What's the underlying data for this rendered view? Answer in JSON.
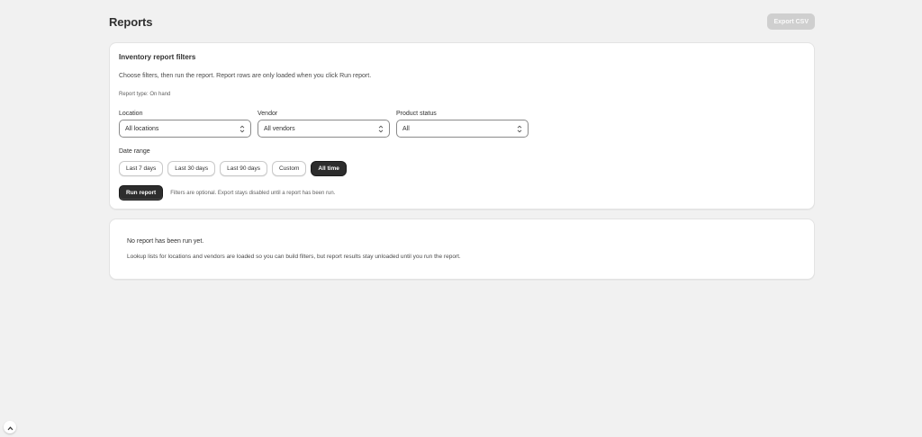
{
  "header": {
    "title": "Reports",
    "export_label": "Export CSV"
  },
  "filters": {
    "title": "Inventory report filters",
    "description": "Choose filters, then run the report. Report rows are only loaded when you click Run report.",
    "report_type": "Report type: On hand",
    "location": {
      "label": "Location",
      "value": "All locations"
    },
    "vendor": {
      "label": "Vendor",
      "value": "All vendors"
    },
    "product_status": {
      "label": "Product status",
      "value": "All"
    },
    "date_range_label": "Date range",
    "date_ranges": [
      {
        "label": "Last 7 days",
        "active": false
      },
      {
        "label": "Last 30 days",
        "active": false
      },
      {
        "label": "Last 90 days",
        "active": false
      },
      {
        "label": "Custom",
        "active": false
      },
      {
        "label": "All time",
        "active": true
      }
    ],
    "run_label": "Run report",
    "run_hint": "Filters are optional. Export stays disabled until a report has been run."
  },
  "results": {
    "title": "No report has been run yet.",
    "description": "Lookup lists for locations and vendors are loaded so you can build filters, but report results stay unloaded until you run the report."
  },
  "icons": {
    "select_chevron": "chevron-up-down-icon",
    "scroll_top": "chevron-up-icon"
  },
  "colors": {
    "page_bg": "#f1f1f1",
    "primary_button": "#2d2d2d",
    "disabled_button": "#cfcfcf"
  }
}
